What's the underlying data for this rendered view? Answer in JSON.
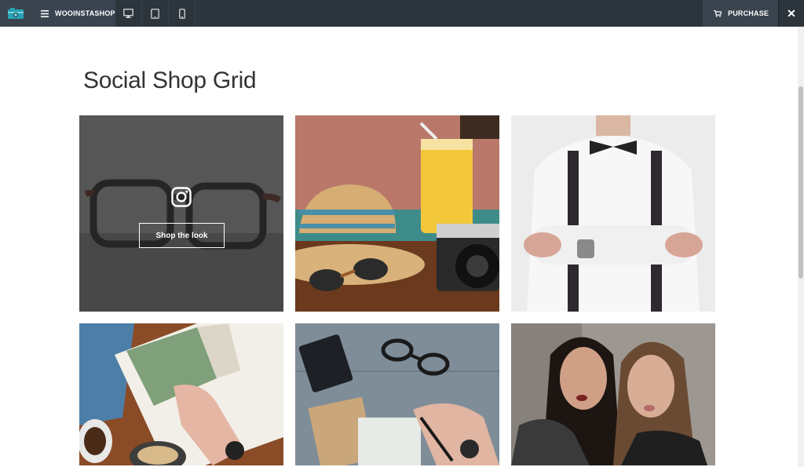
{
  "toolbar": {
    "brand_label": "WOOINSTASHOP",
    "purchase_label": "PURCHASE",
    "close_label": "✕",
    "devices": [
      "desktop",
      "tablet",
      "mobile"
    ]
  },
  "page": {
    "title": "Social Shop Grid"
  },
  "grid": {
    "shop_button_label": "Shop the look",
    "tiles": [
      {
        "name": "eyeglasses",
        "hovered": true
      },
      {
        "name": "straw-hat-camera-juice",
        "hovered": false
      },
      {
        "name": "man-suspenders-bowtie",
        "hovered": false
      },
      {
        "name": "magazine-coffee",
        "hovered": false
      },
      {
        "name": "notebook-glasses-letter",
        "hovered": false
      },
      {
        "name": "two-women-portrait",
        "hovered": false
      }
    ]
  },
  "colors": {
    "toolbar_bg": "#2c343c",
    "accent": "#1a9bb0"
  }
}
